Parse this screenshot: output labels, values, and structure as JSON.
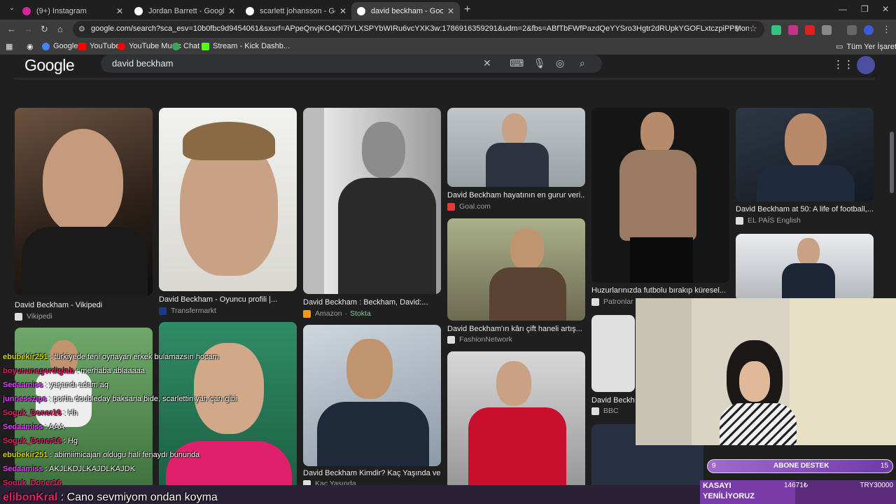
{
  "tabs": [
    {
      "label": "(9+) Instagram"
    },
    {
      "label": "Jordan Barrett - Google'da Ara"
    },
    {
      "label": "scarlett johansson - Google'da"
    },
    {
      "label": "david beckham - Google'da Ara"
    }
  ],
  "address_bar": {
    "url": "google.com/search?sca_esv=10b0fbc9d9454061&sxsrf=APpeQnvjKO4QI7iYLXSPYbWIRu6vcYXK3w:1786916359291&udm=2&fbs=ABfTbFWfPazdQeYYSro3Hgtr2dRUpkYGOFLxtczpiPPMonK6bxzDiCFsgARVFi5PA_rffFfwcZL..."
  },
  "bookmarks": [
    {
      "label": "Google",
      "color": "#4285f4"
    },
    {
      "label": "YouTube",
      "color": "#ff0000"
    },
    {
      "label": "YouTube Music",
      "color": "#ff0000"
    },
    {
      "label": "Chat",
      "color": "#34a853"
    },
    {
      "label": "Stream - Kick Dashb...",
      "color": "#53fc18"
    }
  ],
  "bookmarks_all": "Tüm Yer İşaretleri",
  "google": {
    "logo": "Google",
    "query": "david beckham"
  },
  "results": [
    {
      "caption": "David Beckham - Vikipedi",
      "source": "Vikipedi"
    },
    {
      "caption": "David Beckham - Oyuncu profili |...",
      "source": "Transfermarkt"
    },
    {
      "caption": "David Beckham : Beckham, David:...",
      "source": "Amazon",
      "source_extra": "Stokta"
    },
    {
      "caption": "David Beckham hayatının en gurur veri...",
      "source": "Goal.com"
    },
    {
      "caption": "Huzurlarınızda futbolu bırakıp küresel...",
      "source": "Patronlar"
    },
    {
      "caption": "David Beckham at 50: A life of football,...",
      "source": "EL PAÍS English"
    },
    {
      "caption": "David Beckham'ın kârı çift haneli artış...",
      "source": "FashionNetwork"
    },
    {
      "caption": "David Beckham Kimdir? Kaç Yaşında ve...",
      "source": "Kaç Yaşında"
    },
    {
      "caption": "David Beckh",
      "source": "BBC"
    }
  ],
  "chat": [
    {
      "user": "ebubekir251",
      "msg": "türkiyede teni oynayan erkek bulamazsın hocam",
      "color": "#d4d400"
    },
    {
      "user": "boyununegerdiglab",
      "msg": "merhaba ablaaaaa",
      "color": "#e0206a"
    },
    {
      "user": "Sedaamiss",
      "msg": "yaşandı adam aq",
      "color": "#e040fb"
    },
    {
      "user": "junnesszips",
      "msg": "portia doubleday baksana bide, scarlettin yan çarı gibi",
      "color": "#e040fb"
    },
    {
      "user": "Soguk_Doner16",
      "msg": "Hh",
      "color": "#e0206a"
    },
    {
      "user": "Sedaamiss",
      "msg": "AAA",
      "color": "#e040fb"
    },
    {
      "user": "Soguk_Doner16",
      "msg": "Hg",
      "color": "#e0206a"
    },
    {
      "user": "ebubekir251",
      "msg": "abimiimicajan oldugu hali fenaydı bununda",
      "color": "#d4d400"
    },
    {
      "user": "Sedaamiss",
      "msg": "AKJLKDJLKAJDLKAJDK",
      "color": "#e040fb"
    },
    {
      "user": "Soguk_Doner16",
      "msg": "",
      "color": "#e0206a"
    },
    {
      "user": "elibonKral",
      "msg": "Cano sevmiyom ondan koyma",
      "color": "#e0206a"
    }
  ],
  "overlay": {
    "goal_left": "9",
    "goal_label": "ABONE DESTEK",
    "goal_right": "15",
    "kasayi_line1": "KASAYI",
    "kasayi_line2": "YENİLİYORUZ",
    "amount": "14671₺",
    "currency_right": "TRY30000"
  }
}
